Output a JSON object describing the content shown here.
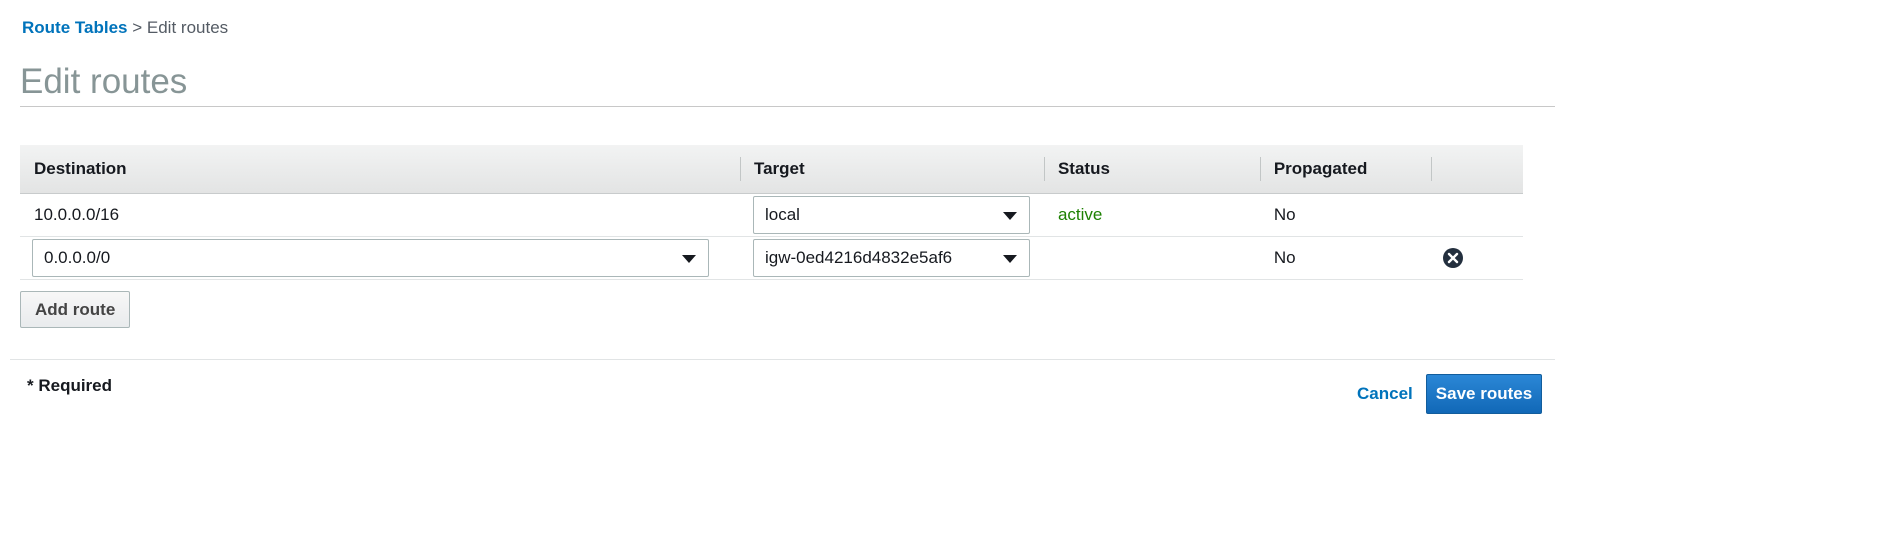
{
  "breadcrumb": {
    "parent_label": "Route Tables",
    "separator": ">",
    "current_label": "Edit routes"
  },
  "page_title": "Edit routes",
  "table": {
    "columns": [
      "Destination",
      "Target",
      "Status",
      "Propagated",
      ""
    ],
    "rows": [
      {
        "destination": "10.0.0.0/16",
        "destination_editable": false,
        "target": "local",
        "status": "active",
        "propagated": "No",
        "removable": false
      },
      {
        "destination": "0.0.0.0/0",
        "destination_editable": true,
        "target": "igw-0ed4216d4832e5af6",
        "status": "",
        "propagated": "No",
        "removable": true
      }
    ]
  },
  "actions": {
    "add_route_label": "Add route",
    "required_note": "* Required",
    "cancel_label": "Cancel",
    "save_label": "Save routes"
  },
  "icons": {
    "dropdown": "chevron-down-icon",
    "remove": "close-circle-icon"
  },
  "colors": {
    "link": "#0073bb",
    "status_active": "#1d8102",
    "primary_button": "#1168b7",
    "title": "#879596"
  }
}
